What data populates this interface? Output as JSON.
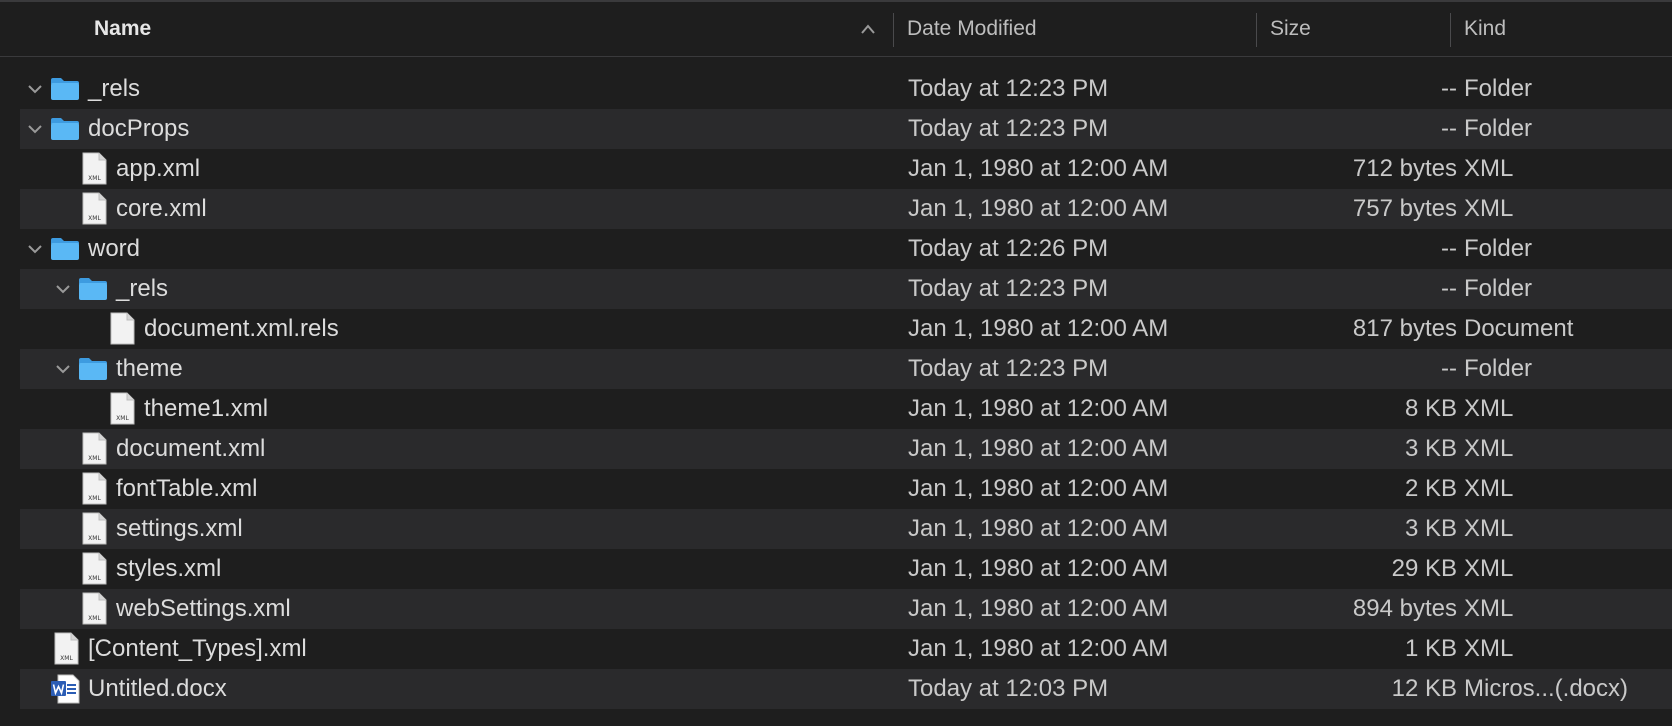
{
  "columns": {
    "name": "Name",
    "date": "Date Modified",
    "size": "Size",
    "kind": "Kind"
  },
  "rows": [
    {
      "level": 0,
      "type": "folder",
      "expanded": true,
      "name": "_rels",
      "date": "Today at 12:23 PM",
      "size": "--",
      "kind": "Folder",
      "icon": "folder-icon"
    },
    {
      "level": 0,
      "type": "folder",
      "expanded": true,
      "name": "docProps",
      "date": "Today at 12:23 PM",
      "size": "--",
      "kind": "Folder",
      "icon": "folder-icon"
    },
    {
      "level": 1,
      "type": "xml",
      "name": "app.xml",
      "date": "Jan 1, 1980 at 12:00 AM",
      "size": "712 bytes",
      "kind": "XML",
      "icon": "xml-file-icon"
    },
    {
      "level": 1,
      "type": "xml",
      "name": "core.xml",
      "date": "Jan 1, 1980 at 12:00 AM",
      "size": "757 bytes",
      "kind": "XML",
      "icon": "xml-file-icon"
    },
    {
      "level": 0,
      "type": "folder",
      "expanded": true,
      "name": "word",
      "date": "Today at 12:26 PM",
      "size": "--",
      "kind": "Folder",
      "icon": "folder-icon"
    },
    {
      "level": 1,
      "type": "folder",
      "expanded": true,
      "name": "_rels",
      "date": "Today at 12:23 PM",
      "size": "--",
      "kind": "Folder",
      "icon": "folder-icon"
    },
    {
      "level": 2,
      "type": "doc",
      "name": "document.xml.rels",
      "date": "Jan 1, 1980 at 12:00 AM",
      "size": "817 bytes",
      "kind": "Document",
      "icon": "document-file-icon"
    },
    {
      "level": 1,
      "type": "folder",
      "expanded": true,
      "name": "theme",
      "date": "Today at 12:23 PM",
      "size": "--",
      "kind": "Folder",
      "icon": "folder-icon"
    },
    {
      "level": 2,
      "type": "xml",
      "name": "theme1.xml",
      "date": "Jan 1, 1980 at 12:00 AM",
      "size": "8 KB",
      "kind": "XML",
      "icon": "xml-file-icon"
    },
    {
      "level": 1,
      "type": "xml",
      "name": "document.xml",
      "date": "Jan 1, 1980 at 12:00 AM",
      "size": "3 KB",
      "kind": "XML",
      "icon": "xml-file-icon"
    },
    {
      "level": 1,
      "type": "xml",
      "name": "fontTable.xml",
      "date": "Jan 1, 1980 at 12:00 AM",
      "size": "2 KB",
      "kind": "XML",
      "icon": "xml-file-icon"
    },
    {
      "level": 1,
      "type": "xml",
      "name": "settings.xml",
      "date": "Jan 1, 1980 at 12:00 AM",
      "size": "3 KB",
      "kind": "XML",
      "icon": "xml-file-icon"
    },
    {
      "level": 1,
      "type": "xml",
      "name": "styles.xml",
      "date": "Jan 1, 1980 at 12:00 AM",
      "size": "29 KB",
      "kind": "XML",
      "icon": "xml-file-icon"
    },
    {
      "level": 1,
      "type": "xml",
      "name": "webSettings.xml",
      "date": "Jan 1, 1980 at 12:00 AM",
      "size": "894 bytes",
      "kind": "XML",
      "icon": "xml-file-icon"
    },
    {
      "level": 0,
      "type": "xml",
      "name": "[Content_Types].xml",
      "date": "Jan 1, 1980 at 12:00 AM",
      "size": "1 KB",
      "kind": "XML",
      "icon": "xml-file-icon"
    },
    {
      "level": 0,
      "type": "word",
      "name": "Untitled.docx",
      "date": "Today at 12:03 PM",
      "size": "12 KB",
      "kind": "Micros...(.docx)",
      "icon": "word-document-icon"
    }
  ],
  "icon_label": "XML",
  "colors": {
    "folder": "#5ab8f5",
    "folder_tab": "#3d9be0",
    "file": "#f2f2f2",
    "word_blue": "#2b5db5"
  }
}
